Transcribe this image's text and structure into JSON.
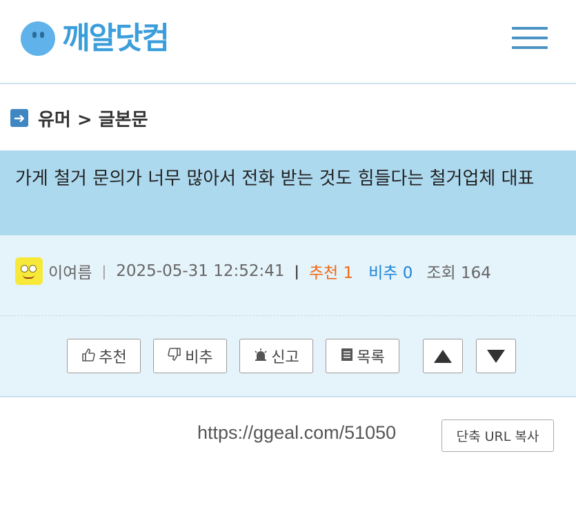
{
  "header": {
    "logo_text": "깨알닷컴",
    "logo_icon": "smiley-face-icon",
    "menu_icon": "hamburger-menu-icon"
  },
  "breadcrumb": {
    "icon": "arrow-right-icon",
    "text": "유머 > 글본문"
  },
  "post": {
    "title": "가게 철거 문의가 너무 많아서 전화 받는 것도 힘들다는 철거업체 대표",
    "author": "이여름",
    "datetime": "2025-05-31 12:52:41",
    "recommend_label": "추천",
    "recommend_count": "1",
    "notrecommend_label": "비추",
    "notrecommend_count": "0",
    "views_label": "조회",
    "views_count": "164"
  },
  "actions": {
    "recommend": "추천",
    "notrecommend": "비추",
    "report": "신고",
    "list": "목록"
  },
  "url": {
    "text": "https://ggeal.com/51050",
    "copy_label": "단축 URL 복사"
  },
  "colors": {
    "accent": "#3b9edb",
    "title_bg": "#add9ef",
    "info_bg": "#e5f3fa",
    "recommend": "#ee6a16",
    "notrecommend": "#1f86d8"
  }
}
